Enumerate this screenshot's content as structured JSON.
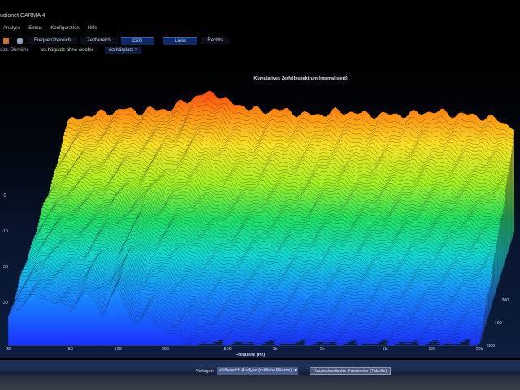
{
  "window": {
    "title": "udionet CARMA 4"
  },
  "menu": [
    "Analyse",
    "Extras",
    "Konfiguration",
    "Hilfe"
  ],
  "toolbar": {
    "buttons": [
      "Frequenzbereich",
      "Zeitbereich",
      "CSD",
      "Links",
      "Rechts"
    ],
    "selected": [
      "CSD",
      "Links"
    ]
  },
  "documents": {
    "items": [
      "eiss Ohrhöhe",
      "wz.hörplatz ohne woofer"
    ],
    "active_tab": "wz.hörplatz",
    "close": "×"
  },
  "bottom": {
    "label": "Vorlagen",
    "select_value": "Vollbereich Analyse (mittlere Räume)",
    "button": "Raumakustische Parameter (Tabelle)"
  },
  "colors": {
    "accent": "#0c2a66",
    "top": "#ff3a10",
    "bottom": "#1a3cff"
  },
  "chart_data": {
    "type": "area",
    "subtype": "waterfall-csd",
    "title": "Kumulatives Zerfallsspektrum (normalisiert)",
    "xlabel": "Frequenz (Hz)",
    "ylabel": "",
    "zlabel": "",
    "x_scale": "log",
    "xlim": [
      20,
      20000
    ],
    "x_ticks": [
      {
        "v": 20,
        "l": "20"
      },
      {
        "v": 50,
        "l": "50"
      },
      {
        "v": 100,
        "l": "100"
      },
      {
        "v": 200,
        "l": "200"
      },
      {
        "v": 500,
        "l": "500"
      },
      {
        "v": 1000,
        "l": "1k"
      },
      {
        "v": 2000,
        "l": "2k"
      },
      {
        "v": 5000,
        "l": "5k"
      },
      {
        "v": 10000,
        "l": "10k"
      },
      {
        "v": 20000,
        "l": "20k"
      }
    ],
    "ylim": [
      -42,
      8
    ],
    "y_ticks": [
      {
        "v": 0,
        "l": "0"
      },
      {
        "v": -10,
        "l": "-10"
      },
      {
        "v": -20,
        "l": "-20"
      },
      {
        "v": -30,
        "l": "-30"
      }
    ],
    "time_ms_range": [
      0,
      500
    ],
    "time_ticks": [
      {
        "v": 300,
        "l": "300"
      },
      {
        "v": 400,
        "l": "400"
      },
      {
        "v": 500,
        "l": "500"
      }
    ],
    "frequencies": [
      20,
      25,
      30,
      40,
      50,
      63,
      80,
      100,
      125,
      160,
      200,
      250,
      315,
      400,
      500,
      630,
      800,
      1000,
      1250,
      1600,
      2000,
      2500,
      3150,
      4000,
      5000,
      6300,
      8000,
      10000,
      12500,
      16000,
      20000
    ],
    "level_0ms_db": [
      -3,
      -1,
      0,
      1,
      2,
      1,
      2,
      2,
      5,
      7,
      8,
      4,
      3,
      1,
      2,
      1,
      0,
      0,
      1,
      1,
      0,
      0,
      0,
      0,
      1,
      1,
      0,
      0,
      -1,
      -2,
      -5
    ],
    "level_500ms_db": [
      -34,
      -30,
      -28,
      -30,
      -32,
      -27,
      -33,
      -26,
      -36,
      -34,
      -38,
      -40,
      -42,
      -42,
      -42,
      -42,
      -42,
      -42,
      -42,
      -42,
      -42,
      -42,
      -42,
      -42,
      -42,
      -42,
      -42,
      -42,
      -42,
      -42,
      -42
    ],
    "grid": true
  }
}
